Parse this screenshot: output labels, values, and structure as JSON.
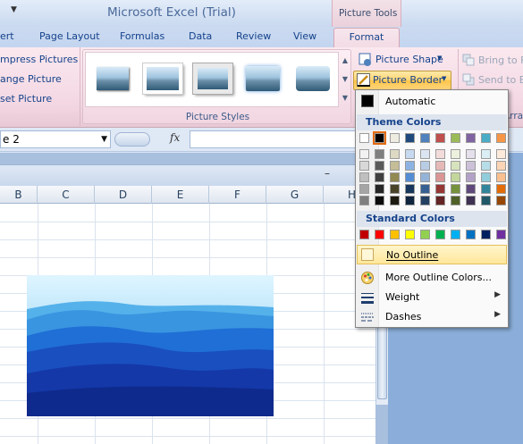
{
  "app": {
    "title": "Microsoft Excel (Trial)",
    "qat_overflow_glyph": "▼",
    "context_group_label": "Picture Tools"
  },
  "tabs": [
    {
      "label": "ert"
    },
    {
      "label": "Page Layout"
    },
    {
      "label": "Formulas"
    },
    {
      "label": "Data"
    },
    {
      "label": "Review"
    },
    {
      "label": "View"
    },
    {
      "label": "Format"
    }
  ],
  "ribbon": {
    "adjust_items": [
      "mpress Pictures",
      "ange Picture",
      "set Picture"
    ],
    "styles_group_label": "Picture Styles",
    "gallery_scroll": [
      "▲",
      "▼",
      "▼"
    ],
    "picture_shape": "Picture Shape",
    "picture_border": "Picture Border",
    "arrange_items": [
      "Bring to F",
      "Send to Ba"
    ],
    "arrange_label": "Arra",
    "accent_color": "#ffd470"
  },
  "formula_bar": {
    "name_box": "e 2",
    "fx": "fx",
    "formula": ""
  },
  "sheet": {
    "columns": [
      "B",
      "C",
      "D",
      "E",
      "F",
      "G",
      "H"
    ],
    "window_min_glyph": "–"
  },
  "menu": {
    "automatic": "Automatic",
    "theme_header": "Theme Colors",
    "theme_top": [
      "#ffffff",
      "#000000",
      "#eeece1",
      "#1f497d",
      "#4f81bd",
      "#c0504d",
      "#9bbb59",
      "#8064a2",
      "#4bacc6",
      "#f79646"
    ],
    "theme_shades": [
      [
        "#f2f2f2",
        "#d8d8d8",
        "#bfbfbf",
        "#a5a5a5",
        "#7f7f7f"
      ],
      [
        "#7f7f7f",
        "#595959",
        "#3f3f3f",
        "#262626",
        "#0c0c0c"
      ],
      [
        "#ddd9c3",
        "#c4bd97",
        "#938953",
        "#494429",
        "#1d1b10"
      ],
      [
        "#c6d9f0",
        "#8db3e2",
        "#548dd4",
        "#17365d",
        "#0f243e"
      ],
      [
        "#dbe5f1",
        "#b8cce4",
        "#95b3d7",
        "#366092",
        "#244061"
      ],
      [
        "#f2dcdb",
        "#e5b9b7",
        "#d99694",
        "#953734",
        "#632423"
      ],
      [
        "#ebf1dd",
        "#d7e3bc",
        "#c3d69b",
        "#76923c",
        "#4f6128"
      ],
      [
        "#e5e0ec",
        "#ccc1d9",
        "#b2a2c7",
        "#5f497a",
        "#3f3151"
      ],
      [
        "#dbeef3",
        "#b7dde8",
        "#92cddc",
        "#31859b",
        "#205867"
      ],
      [
        "#fdeada",
        "#fbd5b5",
        "#fac08f",
        "#e36c09",
        "#974806"
      ]
    ],
    "standard_header": "Standard Colors",
    "standard": [
      "#c00000",
      "#ff0000",
      "#ffc000",
      "#ffff00",
      "#92d050",
      "#00b050",
      "#00b0f0",
      "#0070c0",
      "#002060",
      "#7030a0"
    ],
    "no_outline": "No Outline",
    "more_colors": "More Outline Colors...",
    "weight": "Weight",
    "dashes": "Dashes",
    "submenu_arrow": "▶",
    "selected_swatch": "#000000",
    "selected_outline": "#e26b10"
  }
}
